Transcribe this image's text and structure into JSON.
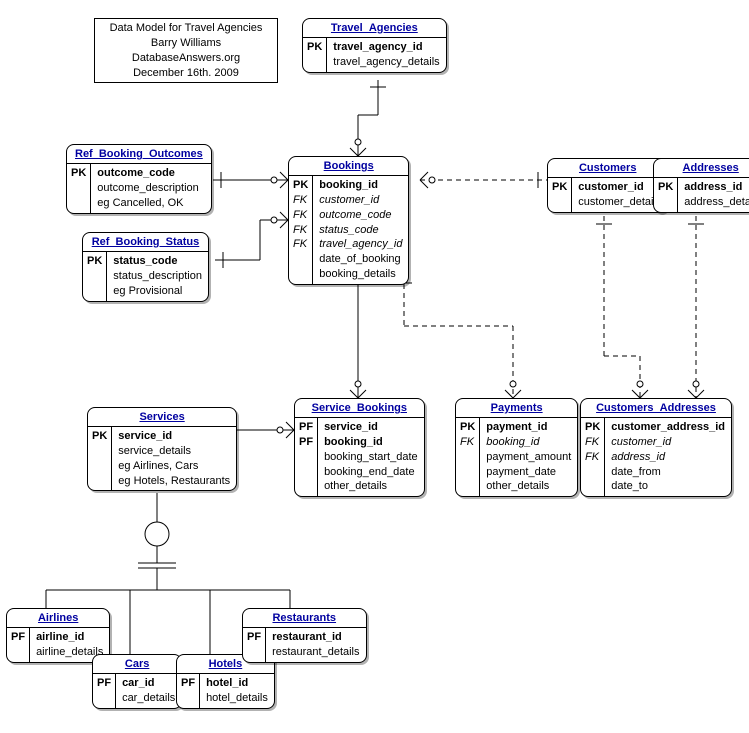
{
  "meta": {
    "line1": "Data Model for Travel Agencies",
    "line2": "Barry Williams",
    "line3": "DatabaseAnswers.org",
    "line4": "December 16th. 2009"
  },
  "entities": {
    "travel_agencies": {
      "title": "Travel_Agencies",
      "keys": [
        "PK",
        ""
      ],
      "attrs": [
        "travel_agency_id",
        "travel_agency_details"
      ]
    },
    "ref_booking_outcomes": {
      "title": "Ref_Booking_Outcomes",
      "keys": [
        "PK",
        "",
        ""
      ],
      "attrs": [
        "outcome_code",
        "outcome_description",
        "eg Cancelled, OK"
      ]
    },
    "ref_booking_status": {
      "title": "Ref_Booking_Status",
      "keys": [
        "PK",
        "",
        ""
      ],
      "attrs": [
        "status_code",
        "status_description",
        "eg Provisional"
      ]
    },
    "bookings": {
      "title": "Bookings",
      "keys": [
        "PK",
        "FK",
        "FK",
        "FK",
        "FK",
        "",
        ""
      ],
      "attrs": [
        "booking_id",
        "customer_id",
        "outcome_code",
        "status_code",
        "travel_agency_id",
        "date_of_booking",
        "booking_details"
      ]
    },
    "customers": {
      "title": "Customers",
      "keys": [
        "PK",
        ""
      ],
      "attrs": [
        "customer_id",
        "customer_details"
      ]
    },
    "addresses": {
      "title": "Addresses",
      "keys": [
        "PK",
        ""
      ],
      "attrs": [
        "address_id",
        "address_details"
      ]
    },
    "services": {
      "title": "Services",
      "keys": [
        "PK",
        "",
        "",
        ""
      ],
      "attrs": [
        "service_id",
        "service_details",
        "eg Airlines, Cars",
        "eg Hotels, Restaurants"
      ]
    },
    "service_bookings": {
      "title": "Service_Bookings",
      "keys": [
        "PF",
        "PF",
        "",
        "",
        ""
      ],
      "attrs": [
        "service_id",
        "booking_id",
        "booking_start_date",
        "booking_end_date",
        "other_details"
      ]
    },
    "payments": {
      "title": "Payments",
      "keys": [
        "PK",
        "FK",
        "",
        "",
        ""
      ],
      "attrs": [
        "payment_id",
        "booking_id",
        "payment_amount",
        "payment_date",
        "other_details"
      ]
    },
    "customers_addresses": {
      "title": "Customers_Addresses",
      "keys": [
        "PK",
        "FK",
        "FK",
        "",
        ""
      ],
      "attrs": [
        "customer_address_id",
        "customer_id",
        "address_id",
        "date_from",
        "date_to"
      ]
    },
    "airlines": {
      "title": "Airlines",
      "keys": [
        "PF",
        ""
      ],
      "attrs": [
        "airline_id",
        "airline_details"
      ]
    },
    "cars": {
      "title": "Cars",
      "keys": [
        "PF",
        ""
      ],
      "attrs": [
        "car_id",
        "car_details"
      ]
    },
    "hotels": {
      "title": "Hotels",
      "keys": [
        "PF",
        ""
      ],
      "attrs": [
        "hotel_id",
        "hotel_details"
      ]
    },
    "restaurants": {
      "title": "Restaurants",
      "keys": [
        "PF",
        ""
      ],
      "attrs": [
        "restaurant_id",
        "restaurant_details"
      ]
    }
  }
}
